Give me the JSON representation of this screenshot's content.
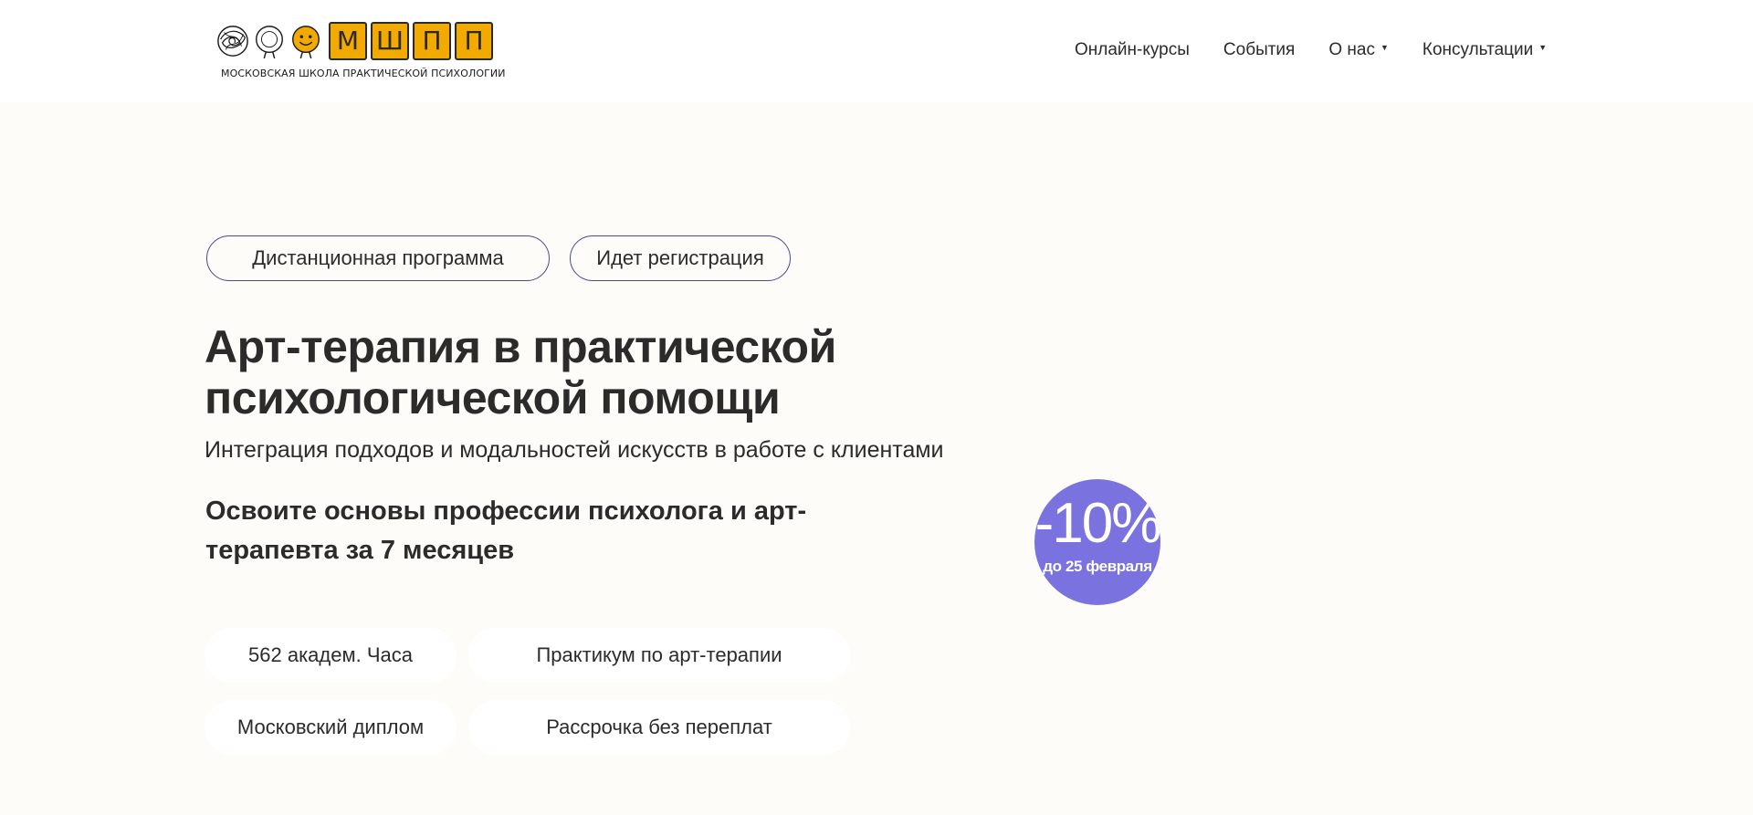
{
  "logo": {
    "tiles": [
      "М",
      "Ш",
      "П",
      "П"
    ],
    "caption": "МОСКОВСКАЯ ШКОЛА ПРАКТИЧЕСКОЙ ПСИХОЛОГИИ",
    "tile_color": "#f2a900"
  },
  "nav": {
    "items": [
      {
        "label": "Онлайн-курсы",
        "dropdown": false
      },
      {
        "label": "События",
        "dropdown": false
      },
      {
        "label": "О нас",
        "dropdown": true
      },
      {
        "label": "Консультации",
        "dropdown": true
      }
    ],
    "caret": "▼"
  },
  "hero": {
    "pills": [
      "Дистанционная программа",
      "Идет регистрация"
    ],
    "title": "Арт-терапия в практической психологической помощи",
    "subtitle": "Интеграция подходов и модальностей искусств в работе с клиентами",
    "lead": "Освоите основы профессии психолога и арт-терапевта за 7 месяцев",
    "discount": {
      "value": "-10%",
      "note": "до 25 февраля",
      "color": "#7a72de"
    },
    "features": [
      "562 академ. Часа",
      "Практикум по арт-терапии",
      "Московский диплом",
      "Рассрочка без переплат"
    ]
  },
  "colors": {
    "background": "#fdfcf8",
    "header_bg": "#ffffff",
    "pill_border": "#4b4a86",
    "text": "#2b2b2b"
  }
}
